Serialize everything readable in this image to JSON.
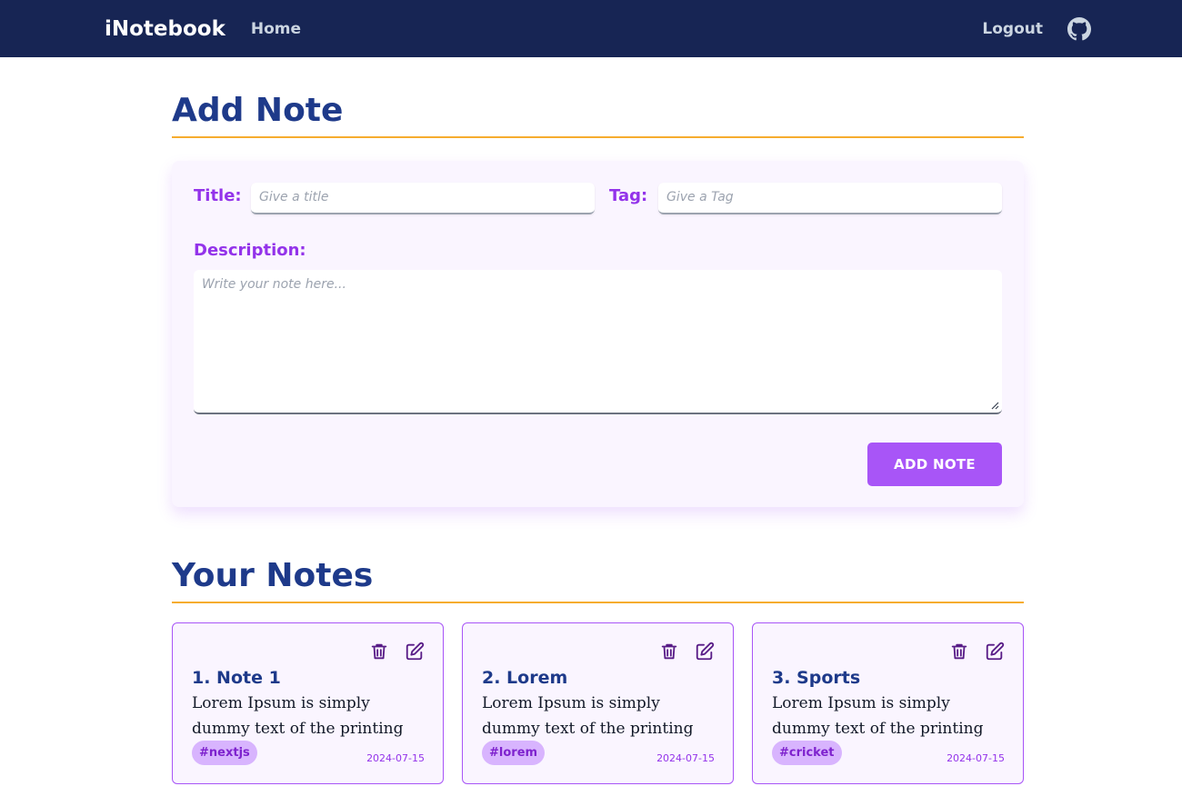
{
  "navbar": {
    "brand": "iNotebook",
    "home": "Home",
    "logout": "Logout",
    "github_icon": "github-icon"
  },
  "add_section": {
    "title": "Add Note",
    "title_label": "Title:",
    "title_placeholder": "Give a title",
    "title_value": "",
    "tag_label": "Tag:",
    "tag_placeholder": "Give a Tag",
    "tag_value": "",
    "description_label": "Description:",
    "description_placeholder": "Write your note here...",
    "description_value": "",
    "submit_label": "ADD NOTE"
  },
  "notes_section": {
    "title": "Your Notes",
    "notes": [
      {
        "title": "1. Note 1",
        "description": "Lorem Ipsum is simply dummy text of the printing and...",
        "tag": "#nextjs",
        "date": "2024-07-15"
      },
      {
        "title": "2. Lorem",
        "description": "Lorem Ipsum is simply dummy text of the printing and...",
        "tag": "#lorem",
        "date": "2024-07-15"
      },
      {
        "title": "3. Sports",
        "description": "Lorem Ipsum is simply dummy text of the printing and...",
        "tag": "#cricket",
        "date": "2024-07-15"
      }
    ]
  },
  "colors": {
    "navbar_bg": "#172554",
    "heading": "#1e3a8a",
    "accent": "#a855f7",
    "label": "#9333ea",
    "divider": "#f59e0b"
  }
}
